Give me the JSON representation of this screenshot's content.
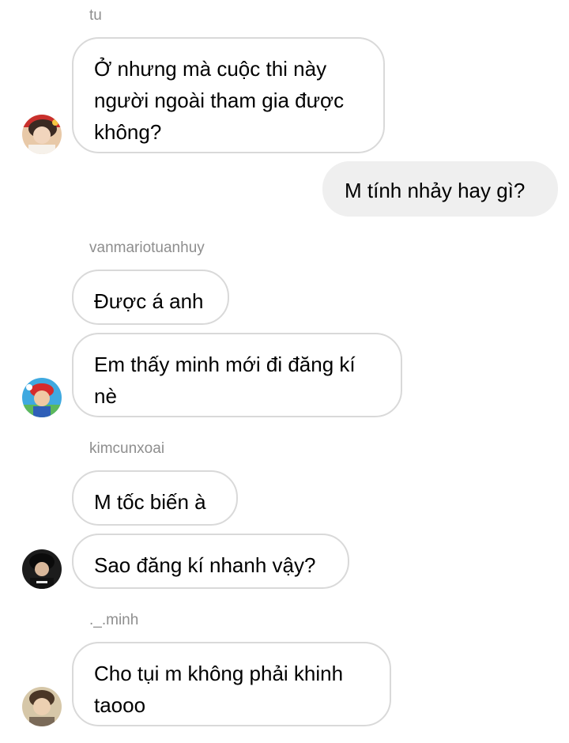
{
  "messages": [
    {
      "sender": "tu",
      "lines": [
        "Ở nhưng mà cuộc thi này",
        "người ngoài tham gia được",
        "không?"
      ]
    },
    {
      "outgoing": "M tính nhảy hay gì?"
    },
    {
      "sender": "vanmariotuanhuy",
      "lines_a": [
        "Được á anh"
      ],
      "lines_b": [
        "Em thấy minh mới đi đăng kí",
        "nè"
      ]
    },
    {
      "sender": "kimcunxoai",
      "lines_a": [
        "M tốc biến à"
      ],
      "lines_b": [
        "Sao đăng kí nhanh vậy?"
      ]
    },
    {
      "sender": "._.minh",
      "lines": [
        "Cho tụi m không phải khinh",
        "taooo"
      ]
    }
  ],
  "colors": {
    "incoming_border": "#d9d9d9",
    "outgoing_background": "#efefef",
    "sender_name": "#8e8e8e"
  },
  "icons": [
    "avatar-tu",
    "avatar-vanmariotuanhuy",
    "avatar-kimcunxoai",
    "avatar-minh"
  ]
}
